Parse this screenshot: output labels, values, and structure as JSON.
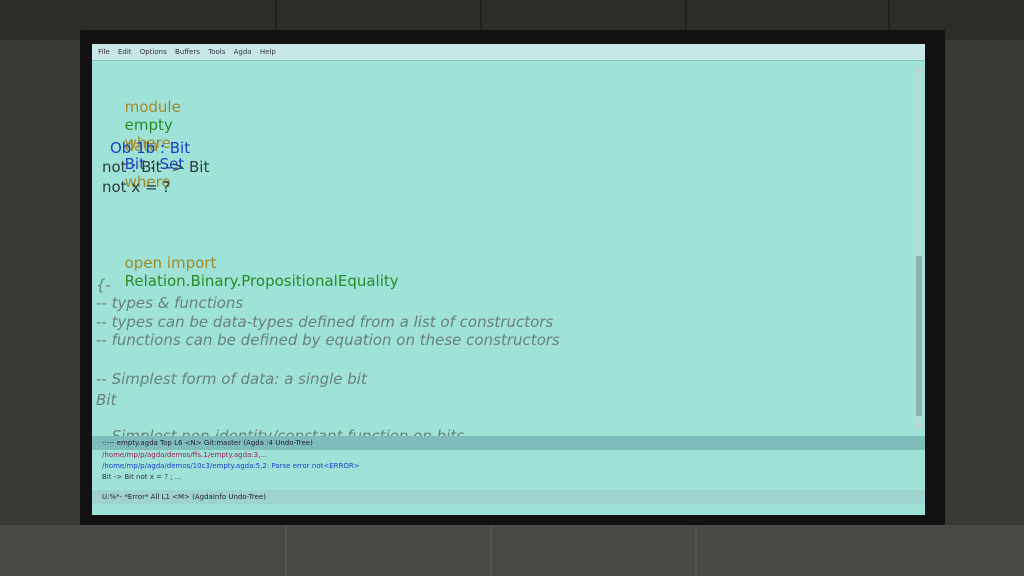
{
  "menubar": {
    "items": [
      "File",
      "Edit",
      "Options",
      "Buffers",
      "Tools",
      "Agda",
      "Help"
    ]
  },
  "editor": {
    "l1_kw1": "module",
    "l1_name": "empty",
    "l1_kw2": "where",
    "l2_kw1": "data",
    "l2_ty": "Bit",
    "l2_colon": " : ",
    "l2_set": "Set",
    "l2_kw2": "where",
    "l3": "Ob 1b : Bit",
    "l4": "not : Bit -> Bit",
    "l5": "not x = ?",
    "l6_kw": "open import",
    "l6_mod": "Relation.Binary.PropositionalEquality",
    "l7": "{-",
    "l8": "-- types & functions",
    "l9": "-- types can be data-types defined from a list of constructors",
    "l10": "-- functions can be defined by equation on these constructors",
    "l11": "-- Simplest form of data: a single bit",
    "l12": "Bit",
    "l13": "-- Simplest non-identity/constant function on bits"
  },
  "modeline": {
    "text": "-:---  empty.agda       Top L6     <N>   Git:master  (Agda :4 Undo-Tree)"
  },
  "minibuffer": {
    "line1": "/home/mp/p/agda/demos/ffs.1/empty.agda:3,...",
    "line2": "/home/mp/p/agda/demos/10c3/empty.agda:5,2:  Parse error not<ERROR>",
    "line3": "Bit -> Bit not x = ? ; ..."
  },
  "modeline2": {
    "text": "U:%*-  *Error*   All L1    <M>   (AgdaInfo Undo-Tree)"
  }
}
